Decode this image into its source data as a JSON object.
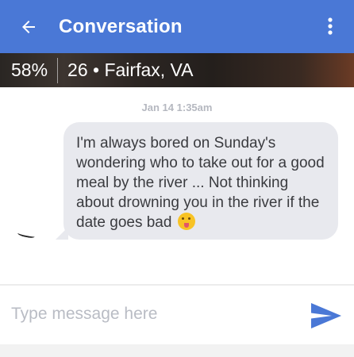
{
  "header": {
    "title": "Conversation",
    "back_icon": "arrow-left-icon",
    "menu_icon": "more-vert-icon",
    "color": "#4a78d6"
  },
  "profile": {
    "match_percent": "58%",
    "info": "26 • Fairfax, VA"
  },
  "chat": {
    "timestamp": "Jan 14 1:35am",
    "messages": [
      {
        "text": "I'm always bored on Sunday's wondering who to take out for a good meal by the river ... Not thinking about drowning you in the river if the date goes bad",
        "emoji": "winking-tongue-emoji"
      }
    ]
  },
  "composer": {
    "placeholder": "Type message here",
    "value": "",
    "send_icon": "send-icon",
    "send_color": "#4a78d6"
  }
}
